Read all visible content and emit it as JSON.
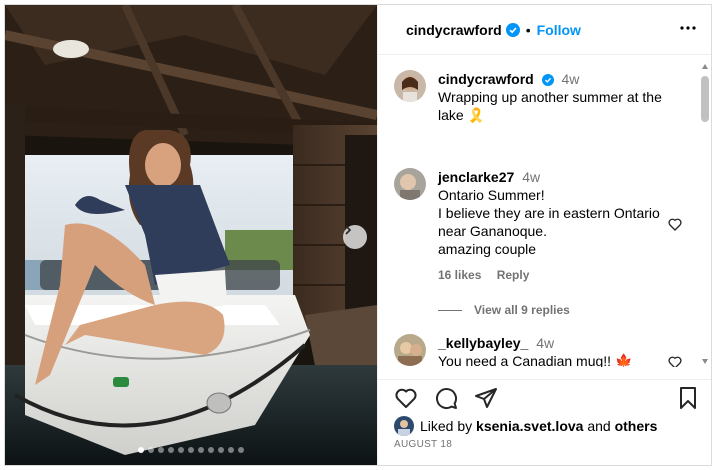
{
  "post": {
    "username": "cindycrawford",
    "follow_label": "Follow",
    "bullet": "•",
    "more_icon": "more-horizontal-icon"
  },
  "caption": {
    "author": "cindycrawford",
    "time": "4w",
    "text": "Wrapping up another summer at the lake",
    "emoji": "🎗️"
  },
  "comments": [
    {
      "author": "jenclarke27",
      "time": "4w",
      "lines": [
        "Ontario Summer!",
        "I believe they are in eastern Ontario near Gananoque.",
        "amazing couple"
      ],
      "likes": "16 likes",
      "reply_label": "Reply",
      "view_replies": "View all 9 replies"
    },
    {
      "author": "_kellybayley_",
      "time": "4w",
      "lines": [
        "You need a Canadian mug!! 🍁"
      ]
    }
  ],
  "likes": {
    "prefix": "Liked by",
    "user": "ksenia.svet.lova",
    "conj": "and",
    "others": "others"
  },
  "date": "AUGUST 18",
  "carousel": {
    "total": 11,
    "active_index": 0
  },
  "colors": {
    "accent": "#0095f6",
    "verified": "#0095f6",
    "secondary_text": "#737373",
    "divider": "#efefef"
  }
}
